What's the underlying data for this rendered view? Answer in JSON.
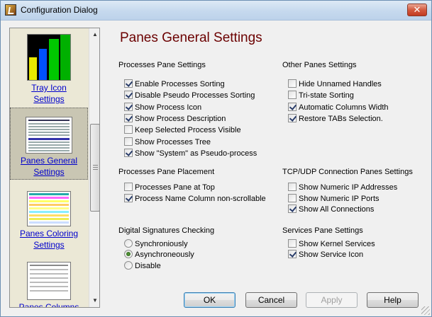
{
  "window": {
    "title": "Configuration Dialog",
    "close_glyph": "✕"
  },
  "nav": {
    "items": [
      {
        "line1": "Tray Icon",
        "line2": "Settings"
      },
      {
        "line1": "Panes General",
        "line2": "Settings"
      },
      {
        "line1": "Panes Coloring",
        "line2": "Settings"
      },
      {
        "line1": "Panes Columns",
        "line2": ""
      }
    ],
    "selected": "Panes General Settings"
  },
  "page": {
    "title": "Panes General Settings"
  },
  "groups": {
    "processes_pane": {
      "title": "Processes Pane Settings",
      "options": [
        {
          "label": "Enable Processes Sorting",
          "checked": true
        },
        {
          "label": "Disable Pseudo Processes Sorting",
          "checked": true
        },
        {
          "label": "Show Process Icon",
          "checked": true
        },
        {
          "label": "Show Process Description",
          "checked": true
        },
        {
          "label": "Keep Selected Process Visible",
          "checked": false
        },
        {
          "label": "Show Processes Tree",
          "checked": false
        },
        {
          "label": "Show \"System\" as Pseudo-process",
          "checked": true
        }
      ]
    },
    "other_panes": {
      "title": "Other Panes Settings",
      "options": [
        {
          "label": "Hide Unnamed Handles",
          "checked": false
        },
        {
          "label": "Tri-state Sorting",
          "checked": false
        },
        {
          "label": "Automatic Columns Width",
          "checked": true
        },
        {
          "label": "Restore TABs Selection.",
          "checked": true
        }
      ]
    },
    "pane_placement": {
      "title": "Processes Pane Placement",
      "options": [
        {
          "label": "Processes Pane at Top",
          "checked": false
        },
        {
          "label": "Process Name Column non-scrollable",
          "checked": true
        }
      ]
    },
    "tcp_udp": {
      "title": "TCP/UDP Connection Panes Settings",
      "options": [
        {
          "label": "Show Numeric IP Addresses",
          "checked": false
        },
        {
          "label": "Show Numeric IP Ports",
          "checked": false
        },
        {
          "label": "Show All Connections",
          "checked": true
        }
      ]
    },
    "signatures": {
      "title": "Digital Signatures Checking",
      "options": [
        {
          "label": "Synchroniously",
          "selected": false
        },
        {
          "label": "Asynchroneously",
          "selected": true
        },
        {
          "label": "Disable",
          "selected": false
        }
      ]
    },
    "services": {
      "title": "Services Pane Settings",
      "options": [
        {
          "label": "Show Kernel Services",
          "checked": false
        },
        {
          "label": "Show Service Icon",
          "checked": true
        }
      ]
    }
  },
  "buttons": {
    "ok": "OK",
    "cancel": "Cancel",
    "apply": "Apply",
    "help": "Help"
  },
  "colors": {
    "page_title": "#6b0000",
    "link": "#0000cc",
    "nav_background": "#ebe8d6",
    "close_button": "#d35a3f"
  },
  "icons": {
    "app": "app-logo-icon",
    "close": "close-icon",
    "scroll_up": "scroll-up-arrow-icon",
    "scroll_down": "scroll-down-arrow-icon"
  }
}
